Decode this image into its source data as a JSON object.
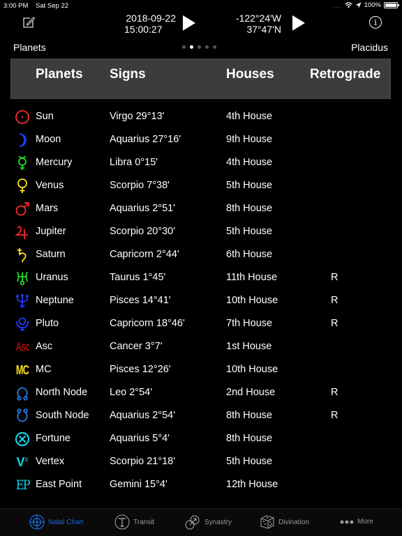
{
  "status_bar": {
    "time": "3:00 PM",
    "date": "Sat Sep 22",
    "signal": "....",
    "battery": "100%"
  },
  "nav": {
    "date": "2018-09-22",
    "time": "15:00:27",
    "longitude": "-122°24'W",
    "latitude": "37°47'N"
  },
  "subheader": {
    "left_label": "Planets",
    "right_label": "Placidus",
    "page_count": 5,
    "active_page": 2
  },
  "table": {
    "headers": [
      "Planets",
      "Signs",
      "Houses",
      "Retrograde"
    ],
    "rows": [
      {
        "symbol": "sun-icon",
        "color": "#ff2a2a",
        "planet": "Sun",
        "sign": "Virgo 29°13'",
        "house": "4th House",
        "retro": ""
      },
      {
        "symbol": "moon-icon",
        "color": "#1f3cff",
        "planet": "Moon",
        "sign": "Aquarius 27°16'",
        "house": "9th House",
        "retro": ""
      },
      {
        "symbol": "mercury-icon",
        "color": "#22e022",
        "planet": "Mercury",
        "sign": "Libra 0°15'",
        "house": "4th House",
        "retro": ""
      },
      {
        "symbol": "venus-icon",
        "color": "#ffe11a",
        "planet": "Venus",
        "sign": "Scorpio 7°38'",
        "house": "5th House",
        "retro": ""
      },
      {
        "symbol": "mars-icon",
        "color": "#ff2a2a",
        "planet": "Mars",
        "sign": "Aquarius 2°51'",
        "house": "8th House",
        "retro": ""
      },
      {
        "symbol": "jupiter-icon",
        "color": "#ff2a2a",
        "planet": "Jupiter",
        "sign": "Scorpio 20°30'",
        "house": "5th House",
        "retro": ""
      },
      {
        "symbol": "saturn-icon",
        "color": "#ffe11a",
        "planet": "Saturn",
        "sign": "Capricorn 2°44'",
        "house": "6th House",
        "retro": ""
      },
      {
        "symbol": "uranus-icon",
        "color": "#22e022",
        "planet": "Uranus",
        "sign": "Taurus 1°45'",
        "house": "11th House",
        "retro": "R"
      },
      {
        "symbol": "neptune-icon",
        "color": "#1f3cff",
        "planet": "Neptune",
        "sign": "Pisces 14°41'",
        "house": "10th House",
        "retro": "R"
      },
      {
        "symbol": "pluto-icon",
        "color": "#1f3cff",
        "planet": "Pluto",
        "sign": "Capricorn 18°46'",
        "house": "7th House",
        "retro": "R"
      },
      {
        "symbol": "asc-icon",
        "color": "#e01010",
        "symbol_text": "Asc",
        "planet": "Asc",
        "sign": "Cancer 3°7'",
        "house": "1st House",
        "retro": ""
      },
      {
        "symbol": "mc-icon",
        "color": "#ffe11a",
        "symbol_text": "MC",
        "planet": "MC",
        "sign": "Pisces 12°26'",
        "house": "10th House",
        "retro": ""
      },
      {
        "symbol": "north-node-icon",
        "color": "#2a7ae2",
        "planet": "North Node",
        "sign": "Leo 2°54'",
        "house": "2nd House",
        "retro": "R"
      },
      {
        "symbol": "south-node-icon",
        "color": "#2a7ae2",
        "planet": "South Node",
        "sign": "Aquarius 2°54'",
        "house": "8th House",
        "retro": "R"
      },
      {
        "symbol": "fortune-icon",
        "color": "#14d2e6",
        "planet": "Fortune",
        "sign": "Aquarius 5°4'",
        "house": "8th House",
        "retro": ""
      },
      {
        "symbol": "vertex-icon",
        "color": "#14d2e6",
        "symbol_text": "Vx",
        "planet": "Vertex",
        "sign": "Scorpio 21°18'",
        "house": "5th House",
        "retro": ""
      },
      {
        "symbol": "east-point-icon",
        "color": "#14d2e6",
        "symbol_text": "EP",
        "planet": "East Point",
        "sign": "Gemini 15°4'",
        "house": "12th House",
        "retro": ""
      }
    ]
  },
  "tabbar": {
    "active_color": "#1a6ad9",
    "inactive_color": "#9a9a9a",
    "items": [
      {
        "label": "Natal Chart",
        "icon": "natal-chart-icon",
        "active": true
      },
      {
        "label": "Transit",
        "icon": "transit-icon",
        "active": false
      },
      {
        "label": "Synastry",
        "icon": "synastry-icon",
        "active": false
      },
      {
        "label": "Divination",
        "icon": "divination-dice-icon",
        "active": false
      },
      {
        "label": "More",
        "icon": "more-dots-icon",
        "active": false
      }
    ]
  }
}
